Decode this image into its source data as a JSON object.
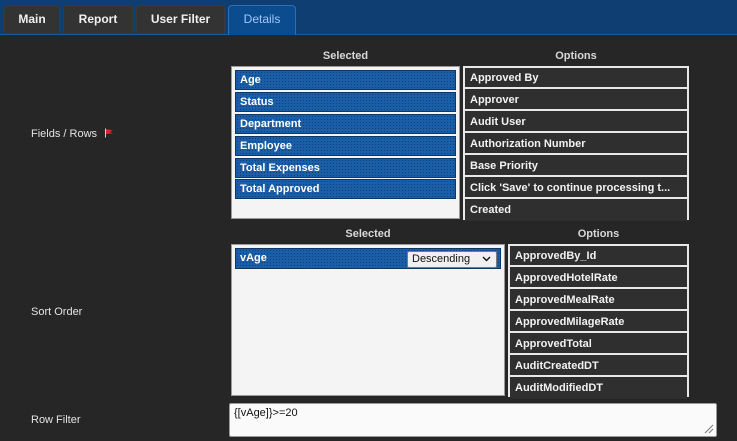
{
  "tabs": [
    {
      "label": "Main",
      "active": false
    },
    {
      "label": "Report",
      "active": false
    },
    {
      "label": "User Filter",
      "active": false
    },
    {
      "label": "Details",
      "active": true
    }
  ],
  "fields_rows": {
    "label": "Fields / Rows",
    "flag_icon": "red-flag-icon",
    "selected_header": "Selected",
    "options_header": "Options",
    "selected": [
      "Age",
      "Status",
      "Department",
      "Employee",
      "Total Expenses",
      "Total Approved"
    ],
    "options": [
      "Approved By",
      "Approver",
      "Audit User",
      "Authorization Number",
      "Base Priority",
      "Click 'Save' to continue processing t...",
      "Created"
    ]
  },
  "sort_order": {
    "label": "Sort Order",
    "selected_header": "Selected",
    "options_header": "Options",
    "selected": [
      {
        "field": "vAge",
        "direction": "Descending"
      }
    ],
    "options": [
      "ApprovedBy_Id",
      "ApprovedHotelRate",
      "ApprovedMealRate",
      "ApprovedMilageRate",
      "ApprovedTotal",
      "AuditCreatedDT",
      "AuditModifiedDT"
    ]
  },
  "row_filter": {
    "label": "Row Filter",
    "value": "{[vAge]}>=20"
  },
  "colors": {
    "tabbar": "#0e3e72",
    "active_tab_text": "#9fc6ff",
    "selected_item": "#1a5ea8"
  }
}
